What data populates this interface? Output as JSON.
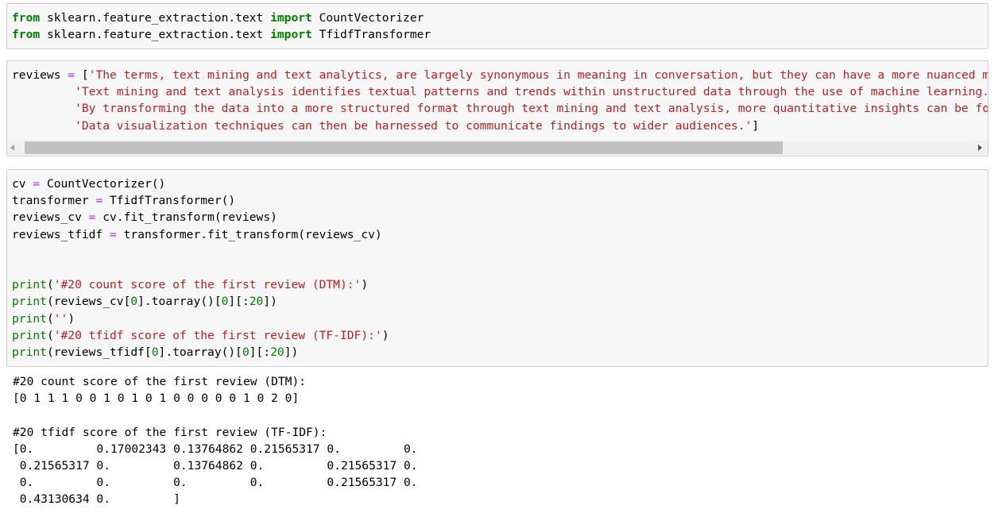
{
  "cells": [
    {
      "lines": [
        [
          {
            "t": "from",
            "c": "kw"
          },
          {
            "t": " sklearn.feature_extraction.text ",
            "c": ""
          },
          {
            "t": "import",
            "c": "kw"
          },
          {
            "t": " CountVectorizer",
            "c": ""
          }
        ],
        [
          {
            "t": "from",
            "c": "kw"
          },
          {
            "t": " sklearn.feature_extraction.text ",
            "c": ""
          },
          {
            "t": "import",
            "c": "kw"
          },
          {
            "t": " TfidfTransformer",
            "c": ""
          }
        ]
      ]
    },
    {
      "lines": [
        [
          {
            "t": "reviews ",
            "c": ""
          },
          {
            "t": "=",
            "c": "op"
          },
          {
            "t": " [",
            "c": ""
          },
          {
            "t": "'The terms, text mining and text analytics, are largely synonymous in meaning in conversation, but they can have a more nuanced meaning.',",
            "c": "str"
          }
        ],
        [
          {
            "t": "         ",
            "c": ""
          },
          {
            "t": "'Text mining and text analysis identifies textual patterns and trends within unstructured data through the use of machine learning.',",
            "c": "str"
          }
        ],
        [
          {
            "t": "         ",
            "c": ""
          },
          {
            "t": "'By transforming the data into a more structured format through text mining and text analysis, more quantitative insights can be found.',",
            "c": "str"
          }
        ],
        [
          {
            "t": "         ",
            "c": ""
          },
          {
            "t": "'Data visualization techniques can then be harnessed to communicate findings to wider audiences.'",
            "c": "str"
          },
          {
            "t": "]",
            "c": ""
          }
        ]
      ]
    },
    {
      "lines": [
        [
          {
            "t": "cv ",
            "c": ""
          },
          {
            "t": "=",
            "c": "op"
          },
          {
            "t": " CountVectorizer()",
            "c": ""
          }
        ],
        [
          {
            "t": "transformer ",
            "c": ""
          },
          {
            "t": "=",
            "c": "op"
          },
          {
            "t": " TfidfTransformer()",
            "c": ""
          }
        ],
        [
          {
            "t": "reviews_cv ",
            "c": ""
          },
          {
            "t": "=",
            "c": "op"
          },
          {
            "t": " cv.fit_transform(reviews)",
            "c": ""
          }
        ],
        [
          {
            "t": "reviews_tfidf ",
            "c": ""
          },
          {
            "t": "=",
            "c": "op"
          },
          {
            "t": " transformer.fit_transform(reviews_cv)",
            "c": ""
          }
        ],
        [],
        [],
        [
          {
            "t": "print",
            "c": "bi"
          },
          {
            "t": "(",
            "c": ""
          },
          {
            "t": "'#20 count score of the first review (DTM):'",
            "c": "str"
          },
          {
            "t": ")",
            "c": ""
          }
        ],
        [
          {
            "t": "print",
            "c": "bi"
          },
          {
            "t": "(reviews_cv[",
            "c": ""
          },
          {
            "t": "0",
            "c": "num"
          },
          {
            "t": "].toarray()[",
            "c": ""
          },
          {
            "t": "0",
            "c": "num"
          },
          {
            "t": "][:",
            "c": ""
          },
          {
            "t": "20",
            "c": "num"
          },
          {
            "t": "])",
            "c": ""
          }
        ],
        [
          {
            "t": "print",
            "c": "bi"
          },
          {
            "t": "(",
            "c": ""
          },
          {
            "t": "''",
            "c": "str"
          },
          {
            "t": ")",
            "c": ""
          }
        ],
        [
          {
            "t": "print",
            "c": "bi"
          },
          {
            "t": "(",
            "c": ""
          },
          {
            "t": "'#20 tfidf score of the first review (TF-IDF):'",
            "c": "str"
          },
          {
            "t": ")",
            "c": ""
          }
        ],
        [
          {
            "t": "print",
            "c": "bi"
          },
          {
            "t": "(reviews_tfidf[",
            "c": ""
          },
          {
            "t": "0",
            "c": "num"
          },
          {
            "t": "].toarray()[",
            "c": ""
          },
          {
            "t": "0",
            "c": "num"
          },
          {
            "t": "][:",
            "c": ""
          },
          {
            "t": "20",
            "c": "num"
          },
          {
            "t": "])",
            "c": ""
          }
        ]
      ]
    }
  ],
  "output": [
    "#20 count score of the first review (DTM):",
    "[0 1 1 1 0 0 1 0 1 0 1 0 0 0 0 0 1 0 2 0]",
    "",
    "#20 tfidf score of the first review (TF-IDF):",
    "[0.         0.17002343 0.13764862 0.21565317 0.         0.",
    " 0.21565317 0.         0.13764862 0.         0.21565317 0.",
    " 0.         0.         0.         0.         0.21565317 0.",
    " 0.43130634 0.         ]"
  ],
  "scrollbar": {
    "position_fraction": 0.0,
    "visible_fraction": 0.8
  }
}
